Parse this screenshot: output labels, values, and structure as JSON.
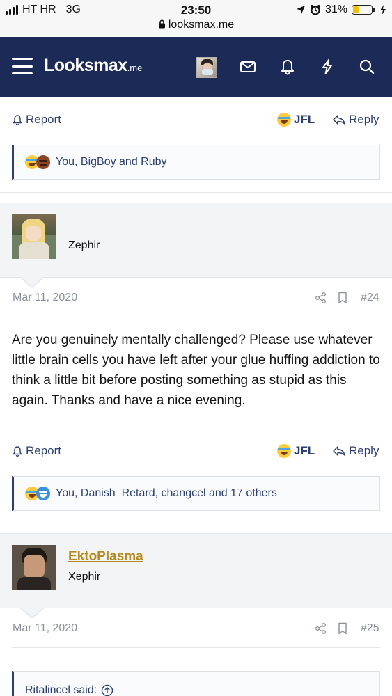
{
  "status_bar": {
    "carrier": "HT HR",
    "network": "3G",
    "time": "23:50",
    "url": "looksmax.me",
    "battery": "31%",
    "battery_level": 0.31
  },
  "nav": {
    "logo_main": "Looksmax",
    "logo_suffix": ".me",
    "brand_color": "#1c2a58"
  },
  "post_prev": {
    "actions": {
      "report": "Report",
      "jfl": "JFL",
      "reply": "Reply"
    },
    "reactions_text": "You, BigBoy and Ruby"
  },
  "post_24": {
    "author_title": "Zephir",
    "date": "Mar 11, 2020",
    "number": "#24",
    "body": "Are you genuinely mentally challenged? Please use whatever little brain cells you have left after your glue huffing addiction to think a little bit before posting something as stupid as this again. Thanks and have a nice evening.",
    "actions": {
      "report": "Report",
      "jfl": "JFL",
      "reply": "Reply"
    },
    "reactions_text": "You, Danish_Retard, changcel and 17 others"
  },
  "post_25": {
    "author_name": "EktoPlasma",
    "author_title": "Xephir",
    "date": "Mar 11, 2020",
    "number": "#25",
    "quote_author": "Ritalincel said:"
  },
  "colors": {
    "accent": "#2c3f6e",
    "username": "#b58a1e"
  }
}
